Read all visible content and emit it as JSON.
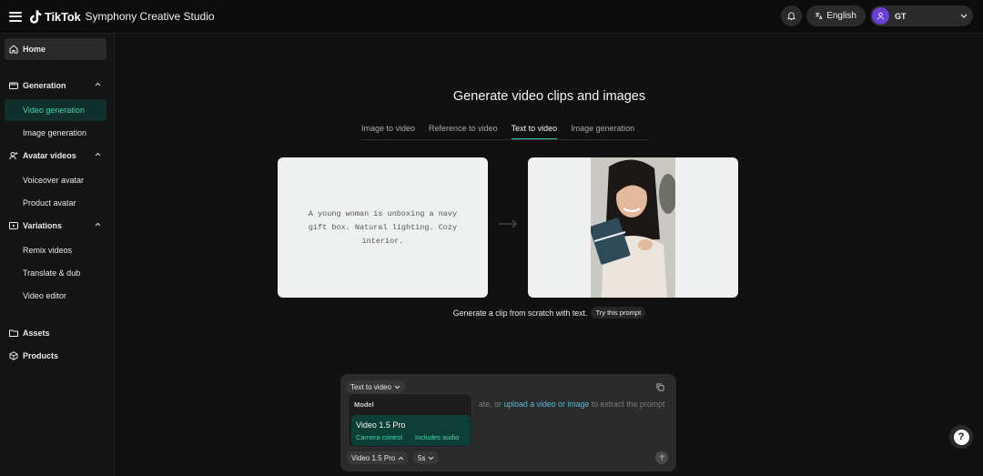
{
  "topbar": {
    "brand": "TikTok",
    "product": "Symphony Creative Studio",
    "language": "English",
    "account_initials": "GT"
  },
  "sidebar": {
    "home": "Home",
    "generation": "Generation",
    "video_generation": "Video generation",
    "image_generation": "Image generation",
    "avatar_videos": "Avatar videos",
    "voiceover_avatar": "Voiceover avatar",
    "product_avatar": "Product avatar",
    "variations": "Variations",
    "remix_videos": "Remix videos",
    "translate_dub": "Translate & dub",
    "video_editor": "Video editor",
    "assets": "Assets",
    "products": "Products"
  },
  "main": {
    "heading": "Generate video clips and images",
    "tabs": [
      "Image to video",
      "Reference to video",
      "Text to video",
      "Image generation"
    ],
    "active_tab": "Text to video",
    "example_prompt": "A young woman is unboxing a navy gift box. Natural lighting. Cozy interior.",
    "caption": "Generate a clip from scratch with text.",
    "try_button": "Try this prompt"
  },
  "composer": {
    "mode": "Text to video",
    "placeholder_pre": "ate, or ",
    "placeholder_link": "upload a video or image",
    "placeholder_post": " to extract the prompt",
    "model_header": "Model",
    "model_name": "Video 1.5 Pro",
    "tag_camera": "Camera control",
    "tag_audio": "Includes audio",
    "model_pill": "Video 1.5 Pro",
    "duration_pill": "5s"
  },
  "colors": {
    "accent": "#3fc7ad",
    "active_bg": "#10312b",
    "link": "#58b9d6",
    "avatar": "#6a3fd6"
  }
}
